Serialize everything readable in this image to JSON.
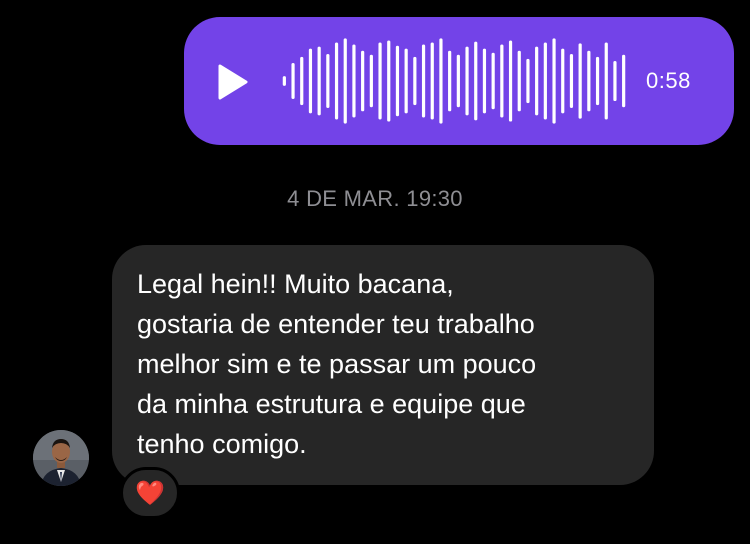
{
  "colors": {
    "background": "#000000",
    "voice_bubble": "#7343e8",
    "incoming_bubble": "#262626",
    "text": "#ffffff",
    "timestamp": "#8e8e93",
    "heart": "#e0242e"
  },
  "voice_message": {
    "play_icon": "play-icon",
    "duration": "0:58",
    "waveform_levels": [
      0.08,
      0.4,
      0.55,
      0.75,
      0.8,
      0.62,
      0.9,
      1.0,
      0.85,
      0.7,
      0.6,
      0.9,
      0.95,
      0.82,
      0.75,
      0.55,
      0.85,
      0.9,
      1.0,
      0.7,
      0.6,
      0.8,
      0.92,
      0.75,
      0.65,
      0.85,
      0.95,
      0.7,
      0.5,
      0.8,
      0.9,
      1.0,
      0.75,
      0.62,
      0.88,
      0.7,
      0.55,
      0.9,
      0.45,
      0.6
    ]
  },
  "timestamp": "4 DE MAR. 19:30",
  "incoming_message": {
    "text": "Legal hein!! Muito bacana,\ngostaria de entender teu trabalho\nmelhor sim e te passar um pouco\nda minha estrutura e equipe que\ntenho comigo.",
    "reaction": "❤️",
    "avatar_icon": "sender-avatar"
  }
}
